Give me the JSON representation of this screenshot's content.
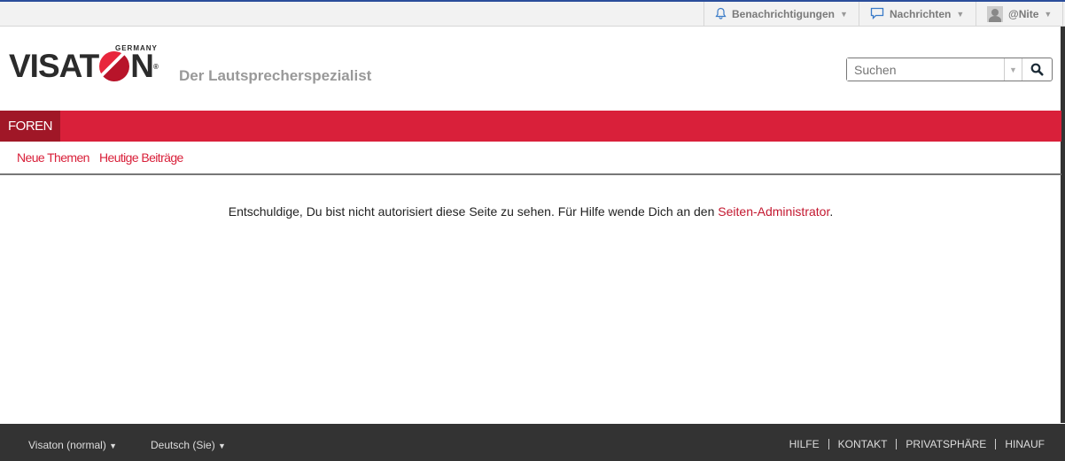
{
  "topbar": {
    "notifications": "Benachrichtigungen",
    "messages": "Nachrichten",
    "user": "@Nite"
  },
  "header": {
    "logo": "VISATON",
    "logo_sub": "GERMANY",
    "tagline": "Der Lautsprecherspezialist"
  },
  "search": {
    "placeholder": "Suchen"
  },
  "nav": {
    "tab": "FOREN",
    "sub": [
      "Neue Themen",
      "Heutige Beiträge"
    ]
  },
  "main": {
    "message": "Entschuldige, Du bist nicht autorisiert diese Seite zu sehen. Für Hilfe wende Dich an den ",
    "link": "Seiten-Administrator",
    "end": "."
  },
  "footer": {
    "style": "Visaton (normal)",
    "language": "Deutsch (Sie)",
    "links": [
      "HILFE",
      "KONTAKT",
      "PRIVATSPHÄRE",
      "HINAUF"
    ]
  }
}
